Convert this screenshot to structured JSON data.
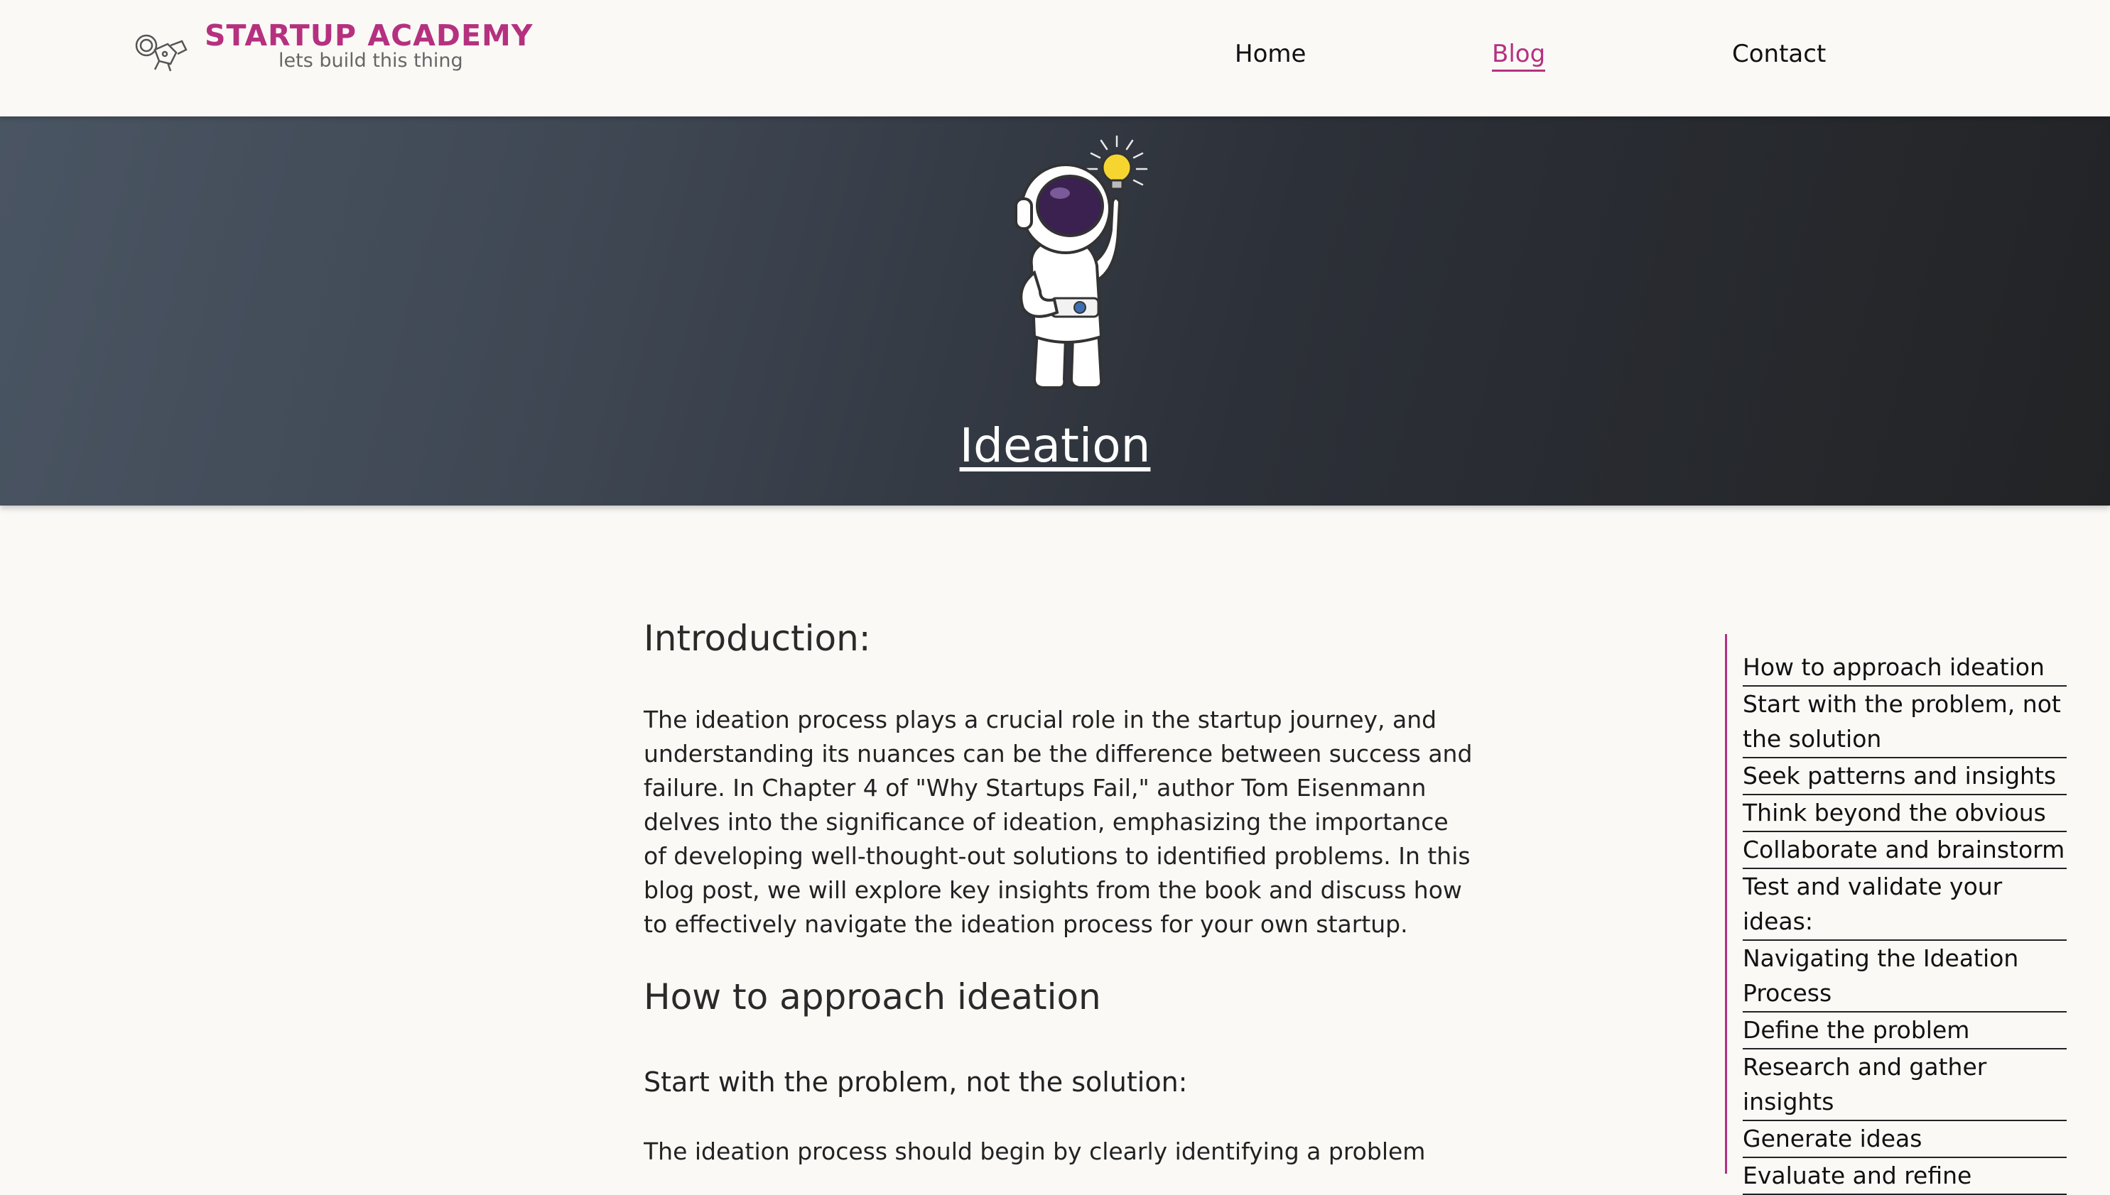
{
  "brand": {
    "title": "STARTUP ACADEMY",
    "tagline": "lets build this thing",
    "color": "#b5317f",
    "icon": "astronaut-outline-icon"
  },
  "nav": {
    "home": "Home",
    "blog": "Blog",
    "contact": "Contact",
    "active": "Blog"
  },
  "hero": {
    "title": "Ideation",
    "illustration": "astronaut-lightbulb-illustration"
  },
  "article": {
    "intro_heading": "Introduction:",
    "intro_paragraph": "The ideation process plays a crucial role in the startup journey, and understanding its nuances can be the difference between success and failure. In Chapter 4 of \"Why Startups Fail,\" author Tom Eisenmann delves into the significance of ideation, emphasizing the importance of developing well-thought-out solutions to identified problems. In this blog post, we will explore key insights from the book and discuss how to effectively navigate the ideation process for your own startup.",
    "approach_heading": "How to approach ideation",
    "start_heading": "Start with the problem, not the solution:",
    "start_paragraph": "The ideation process should begin by clearly identifying a problem"
  },
  "toc": {
    "items": [
      "How to approach ideation",
      "Start with the problem, not the solution",
      "Seek patterns and insights",
      "Think beyond the obvious",
      "Collaborate and brainstorm",
      "Test and validate your ideas:",
      "Navigating the Ideation Process",
      "Define the problem",
      "Research and gather insights",
      "Generate ideas",
      "Evaluate and refine"
    ]
  }
}
